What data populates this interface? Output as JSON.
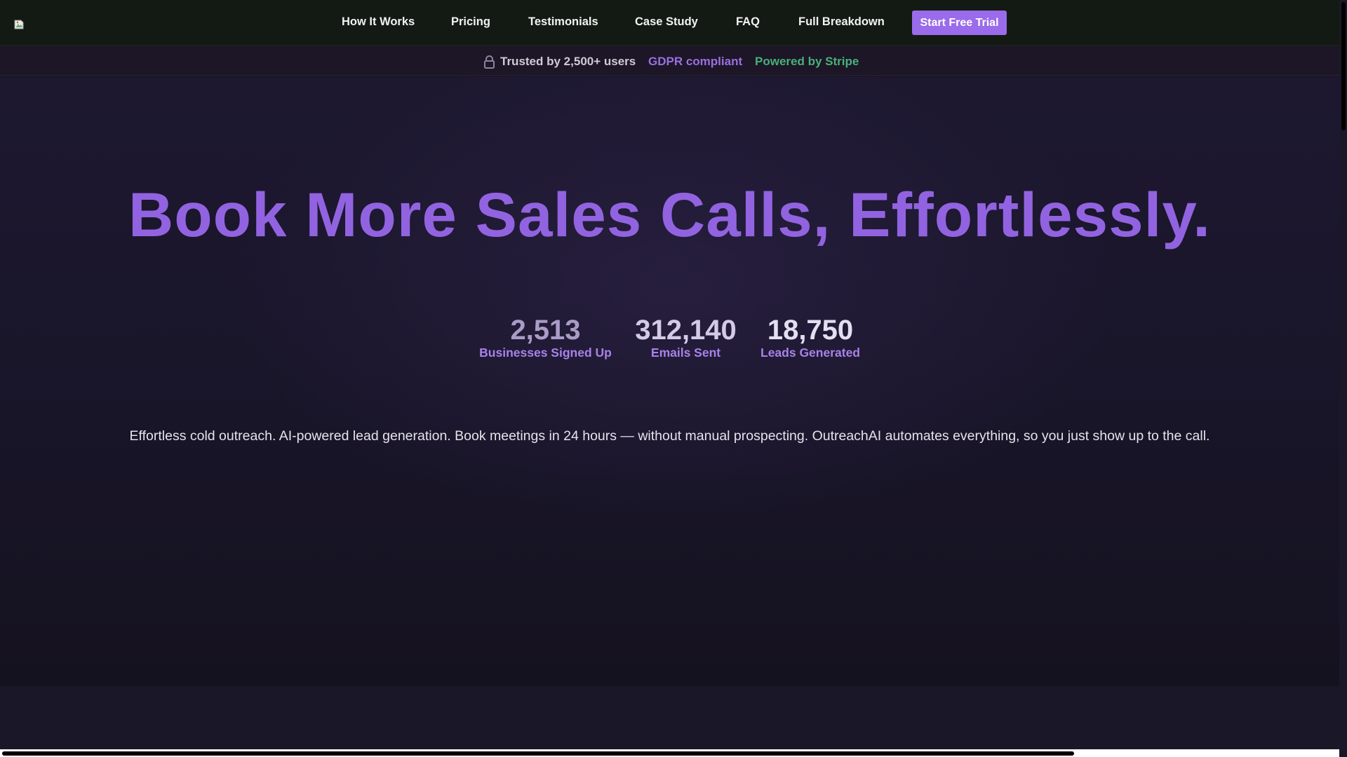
{
  "nav": {
    "links": [
      {
        "label": "How It Works"
      },
      {
        "label": "Pricing"
      },
      {
        "label": "Testimonials"
      },
      {
        "label": "Case Study"
      },
      {
        "label": "FAQ"
      },
      {
        "label": "Full Breakdown"
      }
    ],
    "cta_label": "Start Free Trial"
  },
  "trust": {
    "users": "Trusted by 2,500+ users",
    "gdpr": "GDPR compliant",
    "stripe": "Powered by Stripe"
  },
  "hero": {
    "title": "Book More Sales Calls, Effortlessly.",
    "stats": [
      {
        "value": "2,513",
        "label": "Businesses Signed Up"
      },
      {
        "value": "312,140",
        "label": "Emails Sent"
      },
      {
        "value": "18,750",
        "label": "Leads Generated"
      }
    ],
    "description": "Effortless cold outreach. AI-powered lead generation. Book meetings in 24 hours — without manual prospecting. OutreachAI automates everything, so you just show up to the call."
  },
  "icons": {
    "logo": "broken-image-icon",
    "trust_lock": "lock-icon"
  },
  "colors": {
    "accent": "#9a6bea",
    "title": "#9263e0",
    "gdpr": "#9b6fe0",
    "stripe": "#49b07a",
    "nav_bg": "#131a13"
  }
}
